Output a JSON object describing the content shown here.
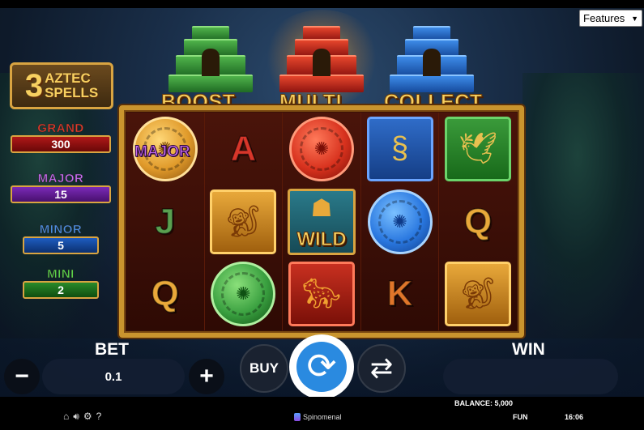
{
  "menu": {
    "features_select": "Features",
    "chevron_icon": "chevron-down-icon"
  },
  "game": {
    "logo": {
      "number": "3",
      "line1": "AZTEC",
      "line2": "SPELLS"
    },
    "feature_labels": {
      "boost": "BOOST",
      "multi": "MULTI",
      "collect": "COLLECT"
    }
  },
  "jackpots": {
    "grand": {
      "label": "GRAND",
      "value": "300",
      "color": "#e23a2a"
    },
    "major": {
      "label": "MAJOR",
      "value": "15",
      "color": "#c66bf0"
    },
    "minor": {
      "label": "MINOR",
      "value": "5",
      "color": "#4a8ee0"
    },
    "mini": {
      "label": "MINI",
      "value": "2",
      "color": "#5ad04a"
    }
  },
  "reels": [
    [
      {
        "type": "coin",
        "color": "gold",
        "icon": "aztec-sun-icon",
        "tag": "MAJOR"
      },
      {
        "type": "letter",
        "text": "J",
        "color": "green"
      },
      {
        "type": "letter",
        "text": "Q",
        "color": "gold"
      }
    ],
    [
      {
        "type": "letter",
        "text": "A",
        "color": "red"
      },
      {
        "type": "tile",
        "color": "gold",
        "icon": "monkey-icon"
      },
      {
        "type": "coin",
        "color": "green",
        "icon": "aztec-sun-icon"
      }
    ],
    [
      {
        "type": "coin",
        "color": "red",
        "icon": "aztec-sun-icon"
      },
      {
        "type": "wild",
        "text": "WILD",
        "icon": "aztec-mask-icon"
      },
      {
        "type": "tile",
        "color": "red",
        "icon": "jaguar-icon"
      }
    ],
    [
      {
        "type": "tile",
        "color": "blue",
        "icon": "serpent-icon"
      },
      {
        "type": "coin",
        "color": "blue",
        "icon": "aztec-sun-icon"
      },
      {
        "type": "letter",
        "text": "K",
        "color": "orange"
      }
    ],
    [
      {
        "type": "tile",
        "color": "green",
        "icon": "bird-icon"
      },
      {
        "type": "letter",
        "text": "Q",
        "color": "gold"
      },
      {
        "type": "tile",
        "color": "gold",
        "icon": "monkey-icon"
      }
    ]
  ],
  "controls": {
    "bet_label": "BET",
    "bet_value": "0.1",
    "minus_label": "−",
    "plus_label": "+",
    "buy_label": "BUY",
    "win_label": "WIN",
    "win_value": ""
  },
  "footer": {
    "balance": "BALANCE: 5,000",
    "brand": "Spinomenal",
    "mode": "FUN",
    "time": "16:06",
    "icons": [
      "home-icon",
      "sound-icon",
      "settings-icon",
      "help-icon"
    ],
    "help_label": "?"
  }
}
